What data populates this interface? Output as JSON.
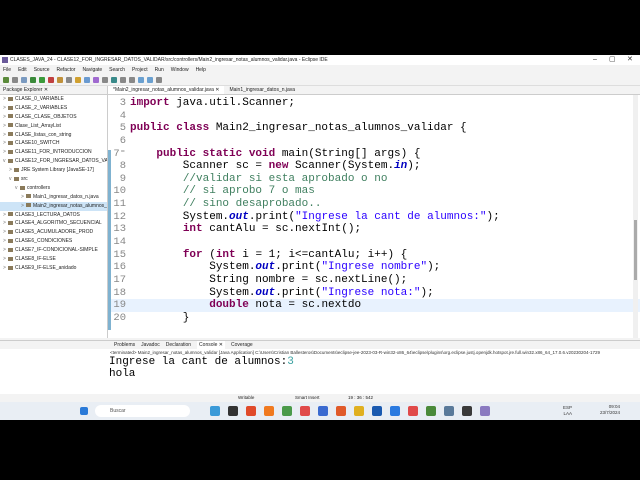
{
  "window": {
    "title": "CLASES_JAVA_24 - CLASE12_FOR_INGRESAR_DATOS_VALIDAR/src/controllers/Main2_ingresar_notas_alumnos_validar.java - Eclipse IDE",
    "minimize": "–",
    "maximize": "▢",
    "close": "✕"
  },
  "menu": [
    "File",
    "Edit",
    "Source",
    "Refactor",
    "Navigate",
    "Search",
    "Project",
    "Run",
    "Window",
    "Help"
  ],
  "package_explorer": {
    "title": "Package Explorer ✕",
    "items": [
      {
        "arrow": ">",
        "label": "CLASE_0_VARIABLE",
        "indent": 0
      },
      {
        "arrow": ">",
        "label": "CLASE_2_VARIABLES",
        "indent": 0
      },
      {
        "arrow": ">",
        "label": "CLASE_CLASE_OBJETOS",
        "indent": 0
      },
      {
        "arrow": ">",
        "label": "Clase_List_ArrayList",
        "indent": 0
      },
      {
        "arrow": ">",
        "label": "CLASE_listas_con_string",
        "indent": 0
      },
      {
        "arrow": ">",
        "label": "CLASE10_SWITCH",
        "indent": 0
      },
      {
        "arrow": ">",
        "label": "CLASE11_FOR_INTRODUCCION",
        "indent": 0
      },
      {
        "arrow": "v",
        "label": "CLASE12_FOR_INGRESAR_DATOS_VALIDAR",
        "indent": 0
      },
      {
        "arrow": ">",
        "label": "JRE System Library [JavaSE-17]",
        "indent": 1
      },
      {
        "arrow": "v",
        "label": "src",
        "indent": 1
      },
      {
        "arrow": "v",
        "label": "controllers",
        "indent": 2
      },
      {
        "arrow": ">",
        "label": "Main1_ingresar_datos_n.java",
        "indent": 3
      },
      {
        "arrow": ">",
        "label": "Main2_ingresar_notas_alumnos_validar.java",
        "indent": 3,
        "selected": true
      },
      {
        "arrow": ">",
        "label": "CLASE3_LECTURA_DATOS",
        "indent": 0
      },
      {
        "arrow": ">",
        "label": "CLASE4_ALGORITMO_SECUENCIAL",
        "indent": 0
      },
      {
        "arrow": ">",
        "label": "CLASE5_ACUMULADORE_PROD",
        "indent": 0
      },
      {
        "arrow": ">",
        "label": "CLASE6_CONDICIONES",
        "indent": 0
      },
      {
        "arrow": ">",
        "label": "CLASE7_IF-CONDICIONAL-SIMPLE",
        "indent": 0
      },
      {
        "arrow": ">",
        "label": "CLASE8_IF-ELSE",
        "indent": 0
      },
      {
        "arrow": ">",
        "label": "CLASE9_IF-ELSE_anidado",
        "indent": 0
      }
    ]
  },
  "editor": {
    "tabs": [
      {
        "label": "*Main2_ingresar_notas_alumnos_validar.java ✕",
        "active": true
      },
      {
        "label": "Main1_ingresar_datos_n.java",
        "active": false
      }
    ],
    "lines": [
      {
        "no": "3",
        "tokens": [
          [
            "kw",
            "import"
          ],
          [
            "pl",
            " java.util.Scanner;"
          ]
        ]
      },
      {
        "no": "4",
        "tokens": []
      },
      {
        "no": "5",
        "tokens": [
          [
            "kw",
            "public class"
          ],
          [
            "pl",
            " Main2_ingresar_notas_alumnos_validar {"
          ]
        ]
      },
      {
        "no": "6",
        "tokens": []
      },
      {
        "no": "7⁼",
        "tokens": [
          [
            "pl",
            "    "
          ],
          [
            "kw",
            "public static void"
          ],
          [
            "pl",
            " main(String[] args) {"
          ]
        ]
      },
      {
        "no": "8",
        "tokens": [
          [
            "pl",
            "        Scanner sc = "
          ],
          [
            "kw",
            "new"
          ],
          [
            "pl",
            " Scanner(System."
          ],
          [
            "fl",
            "in"
          ],
          [
            "pl",
            ");"
          ]
        ]
      },
      {
        "no": "9",
        "tokens": [
          [
            "pl",
            "        "
          ],
          [
            "cm",
            "//validar si esta aprobado o no"
          ]
        ]
      },
      {
        "no": "10",
        "tokens": [
          [
            "pl",
            "        "
          ],
          [
            "cm",
            "// si aprobo 7 o mas"
          ]
        ]
      },
      {
        "no": "11",
        "tokens": [
          [
            "pl",
            "        "
          ],
          [
            "cm",
            "// sino desaprobado.."
          ]
        ]
      },
      {
        "no": "12",
        "tokens": [
          [
            "pl",
            "        System."
          ],
          [
            "fl",
            "out"
          ],
          [
            "pl",
            ".print("
          ],
          [
            "st",
            "\"Ingrese la cant de alumnos:\""
          ],
          [
            "pl",
            ");"
          ]
        ]
      },
      {
        "no": "13",
        "tokens": [
          [
            "pl",
            "        "
          ],
          [
            "kw",
            "int"
          ],
          [
            "pl",
            " cantAlu = sc.nextInt();"
          ]
        ]
      },
      {
        "no": "14",
        "tokens": []
      },
      {
        "no": "15",
        "tokens": [
          [
            "pl",
            "        "
          ],
          [
            "kw",
            "for"
          ],
          [
            "pl",
            " ("
          ],
          [
            "kw",
            "int"
          ],
          [
            "pl",
            " i = 1; i<=cantAlu; i++) {"
          ]
        ]
      },
      {
        "no": "16",
        "tokens": [
          [
            "pl",
            "            System."
          ],
          [
            "fl",
            "out"
          ],
          [
            "pl",
            ".print("
          ],
          [
            "st",
            "\"Ingrese nombre\""
          ],
          [
            "pl",
            ");"
          ]
        ]
      },
      {
        "no": "17",
        "tokens": [
          [
            "pl",
            "            String nombre = sc.nextLine();"
          ]
        ]
      },
      {
        "no": "18",
        "tokens": [
          [
            "pl",
            "            System."
          ],
          [
            "fl",
            "out"
          ],
          [
            "pl",
            ".print("
          ],
          [
            "st",
            "\"Ingrese nota:\""
          ],
          [
            "pl",
            ");"
          ]
        ]
      },
      {
        "no": "19",
        "current": true,
        "tokens": [
          [
            "pl",
            "            "
          ],
          [
            "kw",
            "double"
          ],
          [
            "pl",
            " nota = sc.nextdo"
          ]
        ]
      },
      {
        "no": "20",
        "tokens": [
          [
            "pl",
            "        }"
          ]
        ]
      }
    ]
  },
  "bottom": {
    "tabs": [
      "Problems",
      "Javadoc",
      "Declaration",
      "Console ✕",
      "Coverage"
    ],
    "terminated": "<terminated> Main2_ingresar_notas_alumnos_validar [Java Application] C:\\Users\\Cristian Ballesteros\\Documents\\eclipse-jee-2023-03-R-win32-x86_64\\eclipse\\plugins\\org.eclipse.justj.openjdk.hotspot.jre.full.win32.x86_64_17.0.6.v20230204-1729",
    "console_prompt": "Ingrese la cant de alumnos:",
    "console_input": "3",
    "console_line2": "hola"
  },
  "status": {
    "writable": "Writable",
    "insert": "Smart Insert",
    "position": "19 : 36 : 542"
  },
  "taskbar": {
    "search": "Buscar",
    "lang": "ESP",
    "lang2": "LAA",
    "time": "09:04",
    "date": "23/7/2024"
  }
}
